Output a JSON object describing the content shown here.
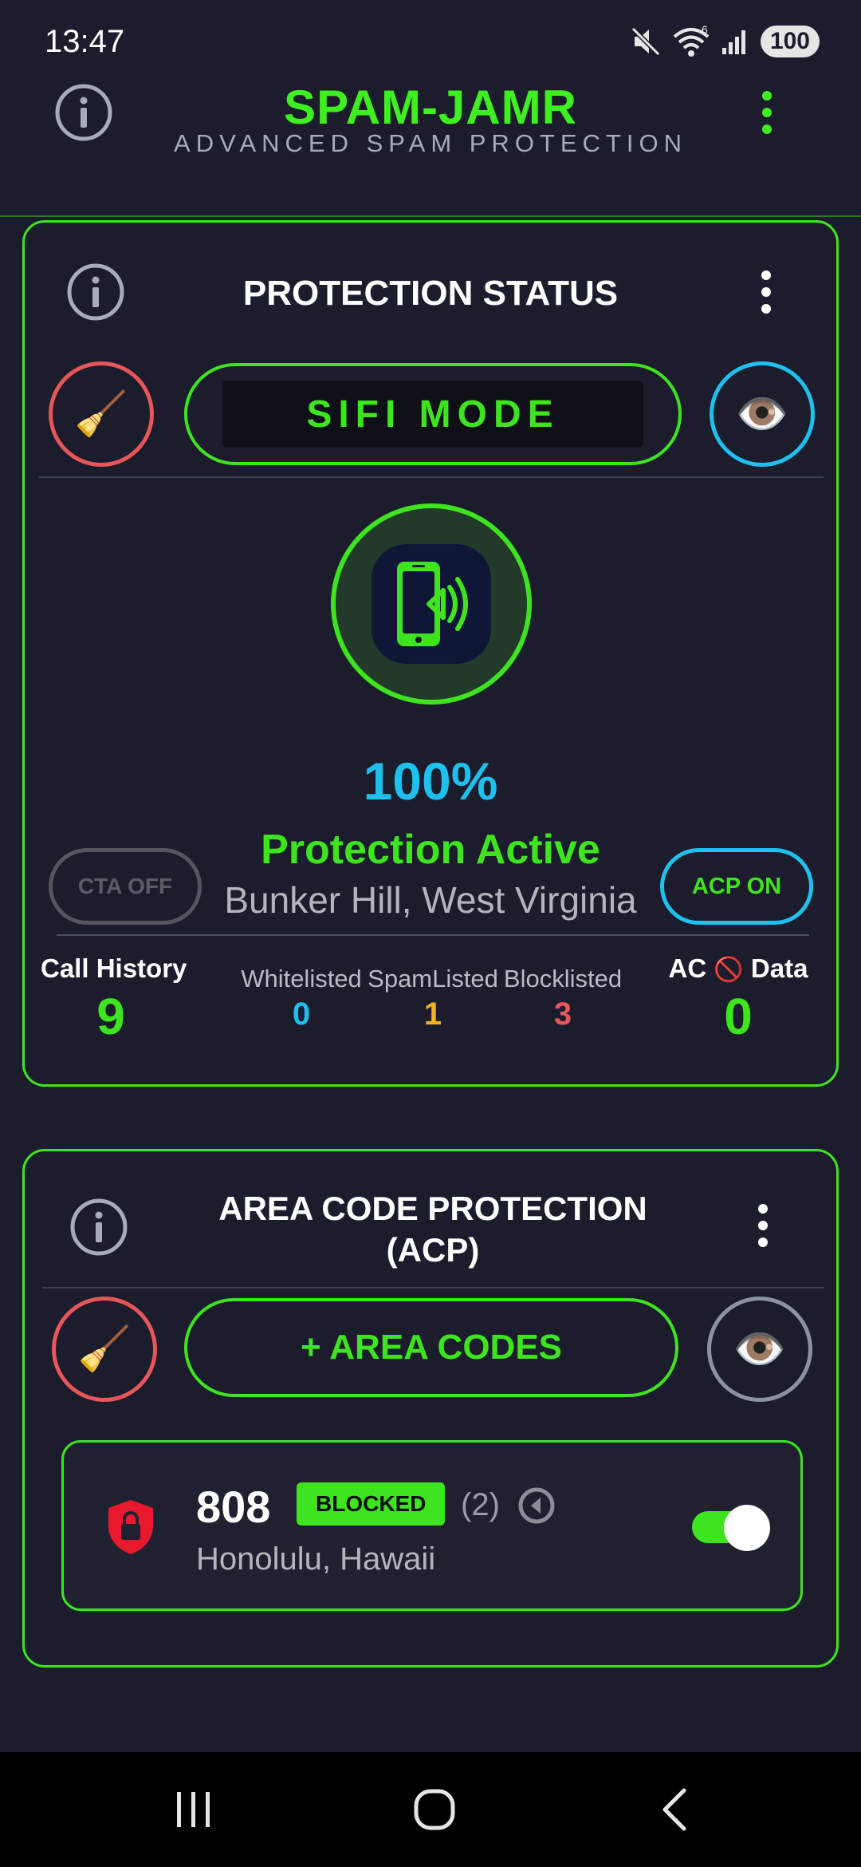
{
  "status_bar": {
    "time": "13:47",
    "battery": "100",
    "network_superscript": "6"
  },
  "header": {
    "title": "SPAM-JAMR",
    "subtitle": "ADVANCED SPAM PROTECTION",
    "accent_color": "#3ef01f"
  },
  "protection_card": {
    "title": "PROTECTION STATUS",
    "mode_label": "SIFI MODE",
    "percent": "100%",
    "status": "Protection Active",
    "location": "Bunker Hill, West Virginia",
    "cta_button": "CTA OFF",
    "acp_button": "ACP ON",
    "clean_icon": "🧹",
    "view_icon": "👁️",
    "stats": {
      "call_history": {
        "label": "Call History",
        "value": "9"
      },
      "whitelisted": {
        "label": "Whitelisted",
        "value": "0",
        "color": "#1ec0ee"
      },
      "spamlisted": {
        "label": "SpamListed",
        "value": "1",
        "color": "#f4b223"
      },
      "blocklisted": {
        "label": "Blocklisted",
        "value": "3",
        "color": "#e9565a"
      },
      "ac_data": {
        "label_prefix": "AC",
        "label_icon": "🚫",
        "label_suffix": "Data",
        "value": "0"
      }
    }
  },
  "acp_card": {
    "title_line1": "AREA CODE PROTECTION",
    "title_line2": "(ACP)",
    "add_button": "+ AREA CODES",
    "clean_icon": "🧹",
    "view_icon": "👁️",
    "items": [
      {
        "code": "808",
        "badge": "BLOCKED",
        "count": "(2)",
        "city": "Honolulu, Hawaii",
        "enabled": true
      }
    ]
  },
  "colors": {
    "background": "#1b1d2c",
    "green": "#3ee51f",
    "blue": "#1ec0ee",
    "red": "#e9565a",
    "yellow": "#f4b223"
  }
}
